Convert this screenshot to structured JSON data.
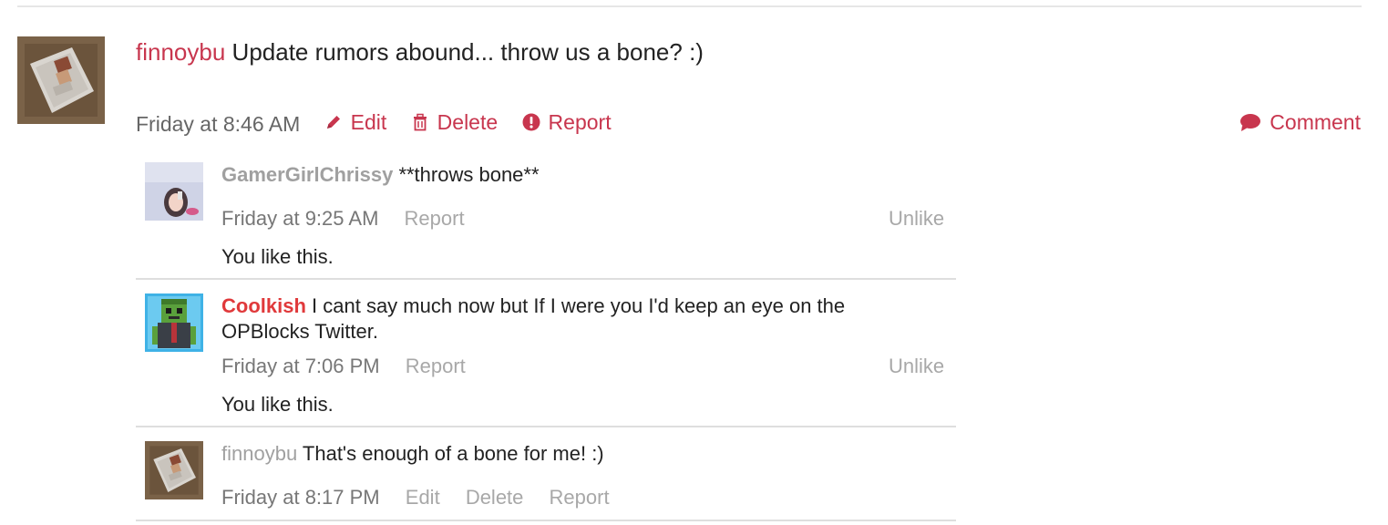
{
  "post": {
    "username": "finnoybu",
    "message": "Update rumors abound... throw us a bone? :)",
    "time": "Friday at 8:46 AM",
    "edit_label": "Edit",
    "delete_label": "Delete",
    "report_label": "Report",
    "comment_label": "Comment"
  },
  "comments": [
    {
      "username": "GamerGirlChrissy",
      "message": "**throws bone**",
      "time": "Friday at 9:25 AM",
      "report_label": "Report",
      "unlike_label": "Unlike",
      "likes": "You like this."
    },
    {
      "username": "Coolkish",
      "message": "I cant say much now but If I were you I'd keep an eye on the OPBlocks Twitter.",
      "time": "Friday at 7:06 PM",
      "report_label": "Report",
      "unlike_label": "Unlike",
      "likes": "You like this."
    },
    {
      "username": "finnoybu",
      "message": "That's enough of a bone for me! :)",
      "time": "Friday at 8:17 PM",
      "edit_label": "Edit",
      "delete_label": "Delete",
      "report_label": "Report"
    }
  ],
  "colors": {
    "accent": "#c8364e",
    "username_red": "#e0393b",
    "muted": "#a8a8a8",
    "divider": "#dedede"
  }
}
